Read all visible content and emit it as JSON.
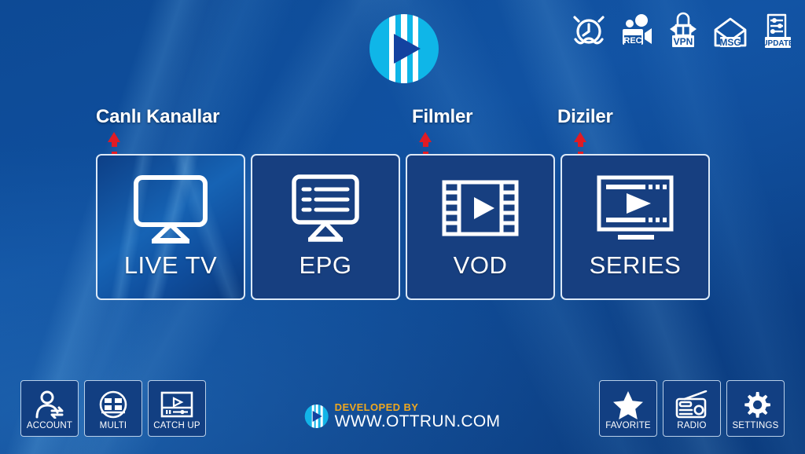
{
  "app": {
    "title": "OTT IPTV Home Screen",
    "brand_logo": "play-circle-logo",
    "background_color": "#0f4f9e",
    "tile_color": "#173f80",
    "tile_selected_color": "#1663b4",
    "accent_white": "#ffffff",
    "annotation_color": "#e01b24",
    "brand_orange": "#f0a81e",
    "logo_cyan": "#12b4e8"
  },
  "status_bar": {
    "items": [
      {
        "icon": "alarm-clock-icon",
        "label": ""
      },
      {
        "icon": "rec-camera-icon",
        "label": "REC"
      },
      {
        "icon": "vpn-lock-icon",
        "label": "VPN"
      },
      {
        "icon": "msg-envelope-icon",
        "label": "MSG"
      },
      {
        "icon": "update-document-icon",
        "label": "UPDATE"
      }
    ]
  },
  "annotations": [
    {
      "text": "Canlı Kanallar",
      "target": "LIVE TV",
      "arrow": "up-dashed-arrow"
    },
    {
      "text": "Filmler",
      "target": "VOD",
      "arrow": "up-dashed-arrow"
    },
    {
      "text": "Diziler",
      "target": "SERIES",
      "arrow": "up-dashed-arrow"
    }
  ],
  "main_tiles": [
    {
      "label": "LIVE TV",
      "icon": "tv-monitor-icon",
      "selected": true
    },
    {
      "label": "EPG",
      "icon": "epg-guide-icon",
      "selected": false
    },
    {
      "label": "VOD",
      "icon": "film-strip-play-icon",
      "selected": false
    },
    {
      "label": "SERIES",
      "icon": "series-screen-play-icon",
      "selected": false
    }
  ],
  "dock_left": [
    {
      "label": "ACCOUNT",
      "icon": "account-person-icon"
    },
    {
      "label": "MULTI",
      "icon": "multi-grid-icon"
    },
    {
      "label": "CATCH UP",
      "icon": "catchup-player-icon"
    }
  ],
  "dock_right": [
    {
      "label": "FAVORITE",
      "icon": "star-icon"
    },
    {
      "label": "RADIO",
      "icon": "radio-icon"
    },
    {
      "label": "SETTINGS",
      "icon": "gear-icon"
    }
  ],
  "footer_brand": {
    "line1": "DEVELOPED BY",
    "line2": "WWW.OTTRUN.COM",
    "logo": "play-circle-logo"
  }
}
